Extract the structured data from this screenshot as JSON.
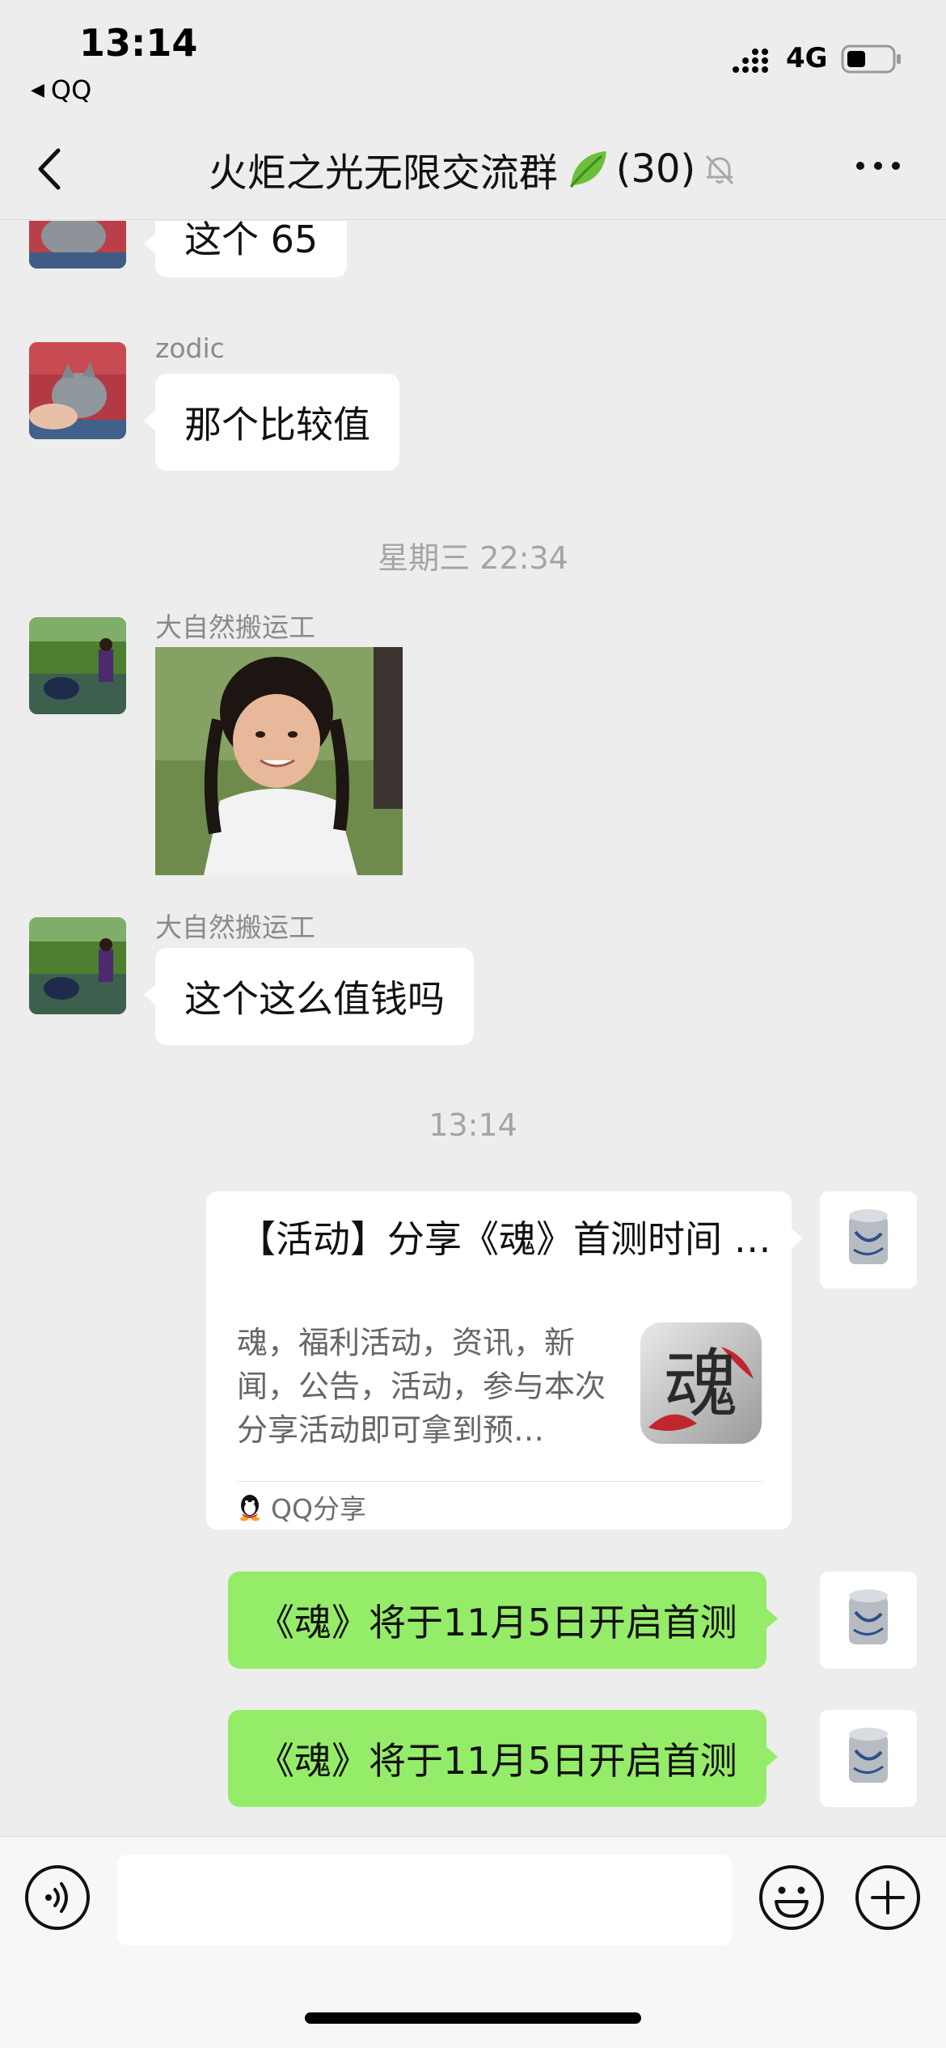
{
  "status_bar": {
    "time": "13:14",
    "back_app": "QQ",
    "network": "4G"
  },
  "nav": {
    "title": "火炬之光无限交流群",
    "member_count": "(30)"
  },
  "messages": {
    "m1": {
      "text": "这个 65"
    },
    "m2": {
      "sender": "zodic",
      "text": "那个比较值"
    },
    "ts1": "星期三 22:34",
    "m3": {
      "sender": "大自然搬运工"
    },
    "m4": {
      "sender": "大自然搬运工",
      "text": "这个这么值钱吗"
    },
    "ts2": "13:14",
    "share": {
      "title": "【活动】分享《魂》首测时间 …",
      "description": "魂，福利活动，资讯，新闻，公告，活动，参与本次分享活动即可拿到预…",
      "thumb_char": "魂",
      "source": "QQ分享"
    },
    "m5": {
      "text": "《魂》将于11月5日开启首测"
    },
    "m6": {
      "text": "《魂》将于11月5日开启首测"
    }
  },
  "input": {
    "placeholder": ""
  },
  "colors": {
    "background": "#ededed",
    "sent_bubble": "#95ec69",
    "received_bubble": "#ffffff"
  }
}
